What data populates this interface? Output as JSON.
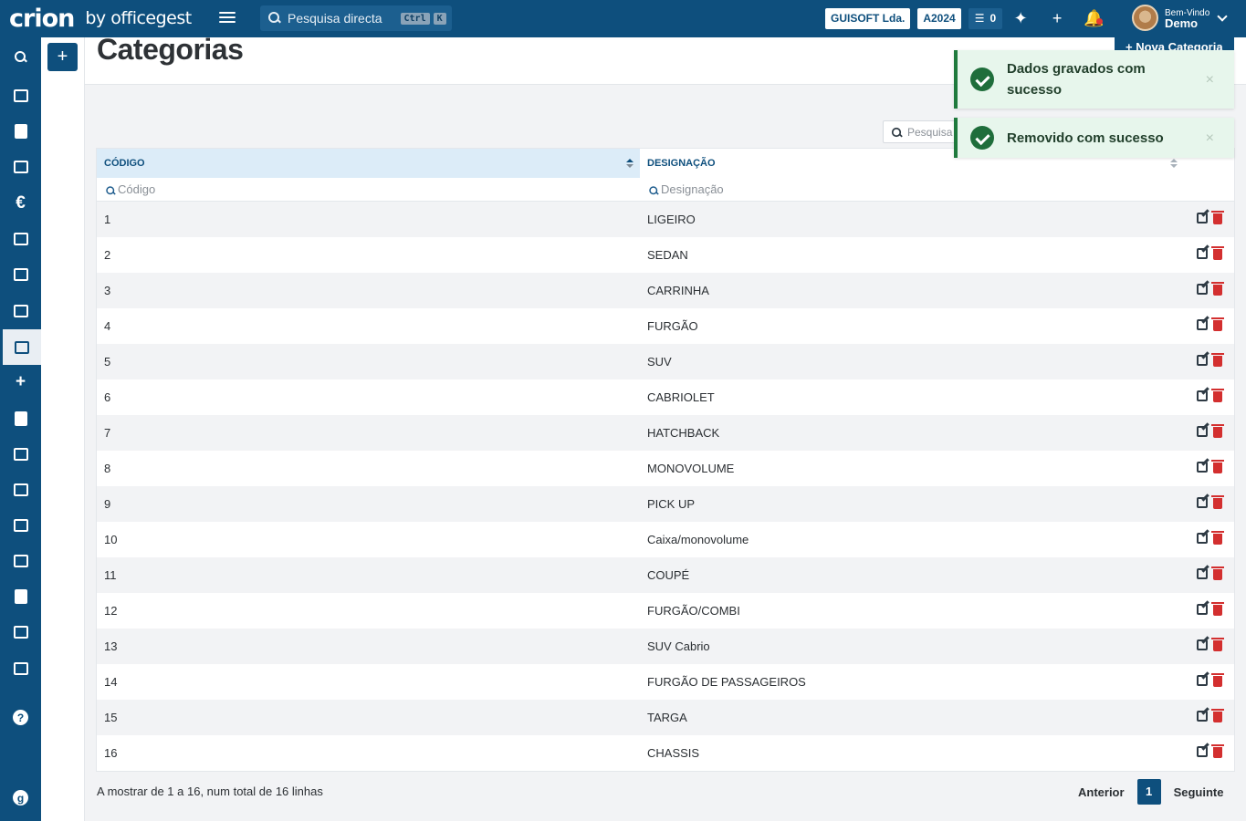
{
  "app": {
    "brand": "crion",
    "by": "by officegest",
    "search_placeholder": "Pesquisa directa",
    "shortcut_keys": [
      "Ctrl",
      "K"
    ],
    "company": "GUISOFT Lda.",
    "year": "A2024",
    "tasks_count": "0",
    "greeting": "Bem-Vindo",
    "user_name": "Demo"
  },
  "sidebar": {
    "items": [
      {
        "icon": "search-icon"
      },
      {
        "icon": "users-icon"
      },
      {
        "icon": "book-icon"
      },
      {
        "icon": "warehouse-icon"
      },
      {
        "icon": "euro-icon",
        "glyph": "€"
      },
      {
        "icon": "cart-icon"
      },
      {
        "icon": "money-icon"
      },
      {
        "icon": "vehicles-icon"
      },
      {
        "icon": "car-icon",
        "active": true
      },
      {
        "icon": "plus-icon",
        "glyph": "+"
      },
      {
        "icon": "calculator-icon"
      },
      {
        "icon": "box-icon"
      },
      {
        "icon": "sitemap-icon"
      },
      {
        "icon": "bank-icon"
      },
      {
        "icon": "chart-icon"
      },
      {
        "icon": "file-icon"
      },
      {
        "icon": "table-icon"
      },
      {
        "icon": "settings-icon"
      },
      {
        "icon": "help-icon",
        "glyph": "?"
      },
      {
        "icon": "officegest-icon",
        "glyph": "g"
      }
    ]
  },
  "page": {
    "title": "Categorias",
    "new_button": "+ Nova Categoria",
    "search_placeholder": "Pesquisa"
  },
  "table": {
    "columns": [
      "CÓDIGO",
      "DESIGNAÇÃO"
    ],
    "filter_placeholders": [
      "Código",
      "Designação"
    ],
    "rows": [
      {
        "code": "1",
        "name": "LIGEIRO"
      },
      {
        "code": "2",
        "name": "SEDAN"
      },
      {
        "code": "3",
        "name": "CARRINHA"
      },
      {
        "code": "4",
        "name": "FURGÃO"
      },
      {
        "code": "5",
        "name": "SUV"
      },
      {
        "code": "6",
        "name": "CABRIOLET"
      },
      {
        "code": "7",
        "name": "HATCHBACK"
      },
      {
        "code": "8",
        "name": "MONOVOLUME"
      },
      {
        "code": "9",
        "name": "PICK UP"
      },
      {
        "code": "10",
        "name": "Caixa/monovolume"
      },
      {
        "code": "11",
        "name": "COUPÉ"
      },
      {
        "code": "12",
        "name": "FURGÃO/COMBI"
      },
      {
        "code": "13",
        "name": "SUV Cabrio"
      },
      {
        "code": "14",
        "name": "FURGÃO DE PASSAGEIROS"
      },
      {
        "code": "15",
        "name": "TARGA"
      },
      {
        "code": "16",
        "name": "CHASSIS"
      }
    ]
  },
  "footer": {
    "info": "A mostrar de 1 a 16, num total de 16 linhas",
    "prev": "Anterior",
    "page": "1",
    "next": "Seguinte"
  },
  "toasts": [
    {
      "message": "Dados gravados com sucesso",
      "close": "×"
    },
    {
      "message": "Removido com sucesso",
      "close": "×"
    }
  ],
  "colors": {
    "primary": "#0e4f7d",
    "success": "#1f6e3b",
    "danger": "#d32f2f"
  }
}
